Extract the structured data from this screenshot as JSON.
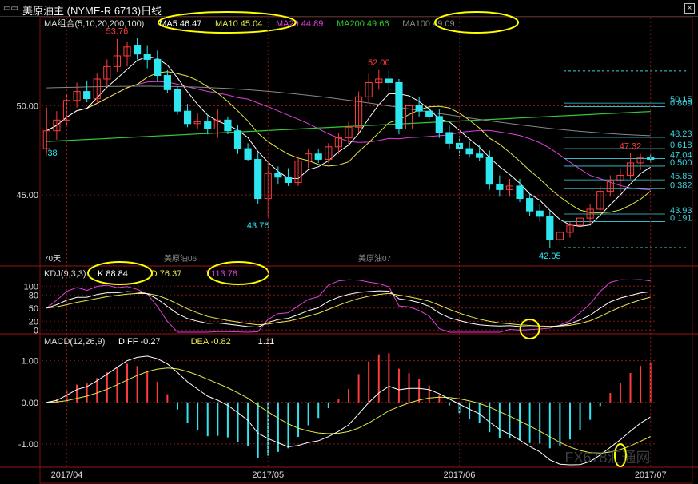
{
  "window": {
    "title": "美原油主 (NYME-R 6713)日线",
    "control": "▭▭",
    "close": "×"
  },
  "colors": {
    "up": "#ff3c3c",
    "down": "#2ee6f0",
    "ma5": "#ffffff",
    "ma10": "#e8e84a",
    "ma20": "#e040e0",
    "ma200": "#34c834",
    "ma100": "#888888",
    "grid": "#8a1414",
    "axisText": "#dddddd",
    "highlight": "#ffff00",
    "fib": "#3bd4e0"
  },
  "icons": {
    "window": "window-control-icon",
    "close": "close-icon"
  },
  "chart_data": [
    {
      "type": "candlestick",
      "panel": "price",
      "title_legend": [
        {
          "name": "MA组合(5,10,20,200,100)",
          "color": "#dddddd"
        },
        {
          "name": "MA5",
          "value": "46.47",
          "color": "#ffffff"
        },
        {
          "name": "MA10",
          "value": "45.04",
          "color": "#e8e84a"
        },
        {
          "name": "MA20",
          "value": "44.89",
          "color": "#e040e0"
        },
        {
          "name": "MA200",
          "value": "49.66",
          "color": "#34c834"
        },
        {
          "name": "MA100",
          "value": "49.09",
          "color": "#888888"
        }
      ],
      "ylim": [
        41.6,
        54.5
      ],
      "ytick_labels": [
        "50.00",
        "45.00"
      ],
      "ytick_values": [
        50,
        45
      ],
      "xtick_labels": [
        "2017/04",
        "2017/05",
        "2017/06",
        "2017/07"
      ],
      "xtick_index": [
        2,
        22,
        41,
        60
      ],
      "contract_labels": [
        "70天",
        "美原油06",
        "美原油07"
      ],
      "annotations": [
        {
          "text": "53.76",
          "index": 7,
          "value": 53.76
        },
        {
          "text": "52.00",
          "index": 33,
          "value": 52.0
        },
        {
          "text": "43.76",
          "index": 21,
          "value": 43.76
        },
        {
          "text": "42.05",
          "index": 50,
          "value": 42.05
        },
        {
          "text": "47.32",
          "index": 58,
          "value": 47.32
        },
        {
          "text": ".38",
          "index": 0,
          "value": 47.38
        }
      ],
      "fib_levels": [
        {
          "label": "50.15",
          "value": 50.15
        },
        {
          "label": "0.809",
          "value": 49.95
        },
        {
          "label": "48.23",
          "value": 48.23
        },
        {
          "label": "0.618",
          "value": 47.6
        },
        {
          "label": "47.04",
          "value": 47.04
        },
        {
          "label": "0.500",
          "value": 46.62
        },
        {
          "label": "45.85",
          "value": 45.85
        },
        {
          "label": "0.382",
          "value": 45.35
        },
        {
          "label": "43.93",
          "value": 43.93
        },
        {
          "label": "0.191",
          "value": 43.5
        }
      ],
      "fib_extra_lines": [
        51.95,
        42.05
      ],
      "candles": [
        {
          "o": 47.6,
          "h": 49.9,
          "l": 47.3,
          "c": 48.6
        },
        {
          "o": 48.6,
          "h": 49.7,
          "l": 48.1,
          "c": 49.2
        },
        {
          "o": 49.2,
          "h": 50.7,
          "l": 48.9,
          "c": 50.3
        },
        {
          "o": 50.3,
          "h": 51.3,
          "l": 49.9,
          "c": 50.8
        },
        {
          "o": 50.8,
          "h": 51.4,
          "l": 50.2,
          "c": 50.4
        },
        {
          "o": 50.4,
          "h": 51.8,
          "l": 50.2,
          "c": 51.5
        },
        {
          "o": 51.5,
          "h": 52.6,
          "l": 51.1,
          "c": 52.2
        },
        {
          "o": 52.2,
          "h": 53.76,
          "l": 51.9,
          "c": 52.8
        },
        {
          "o": 52.8,
          "h": 53.6,
          "l": 52.2,
          "c": 53.3
        },
        {
          "o": 53.4,
          "h": 53.8,
          "l": 52.6,
          "c": 52.9
        },
        {
          "o": 52.9,
          "h": 53.4,
          "l": 52.1,
          "c": 52.6
        },
        {
          "o": 52.6,
          "h": 53.1,
          "l": 51.4,
          "c": 51.7
        },
        {
          "o": 51.7,
          "h": 52.0,
          "l": 50.7,
          "c": 50.9
        },
        {
          "o": 50.9,
          "h": 51.1,
          "l": 49.5,
          "c": 49.7
        },
        {
          "o": 49.7,
          "h": 50.1,
          "l": 48.8,
          "c": 49.0
        },
        {
          "o": 49.0,
          "h": 49.6,
          "l": 48.7,
          "c": 49.1
        },
        {
          "o": 49.1,
          "h": 49.5,
          "l": 48.4,
          "c": 48.7
        },
        {
          "o": 48.7,
          "h": 49.8,
          "l": 48.2,
          "c": 49.2
        },
        {
          "o": 49.2,
          "h": 49.4,
          "l": 48.4,
          "c": 48.6
        },
        {
          "o": 48.6,
          "h": 48.9,
          "l": 47.3,
          "c": 47.6
        },
        {
          "o": 47.6,
          "h": 47.9,
          "l": 46.9,
          "c": 47.0
        },
        {
          "o": 47.0,
          "h": 47.4,
          "l": 44.5,
          "c": 44.8
        },
        {
          "o": 44.8,
          "h": 46.8,
          "l": 43.76,
          "c": 46.2
        },
        {
          "o": 46.2,
          "h": 46.6,
          "l": 45.6,
          "c": 46.0
        },
        {
          "o": 46.0,
          "h": 46.5,
          "l": 45.5,
          "c": 45.7
        },
        {
          "o": 45.7,
          "h": 47.1,
          "l": 45.5,
          "c": 46.9
        },
        {
          "o": 46.9,
          "h": 47.6,
          "l": 46.5,
          "c": 47.3
        },
        {
          "o": 47.3,
          "h": 47.6,
          "l": 46.8,
          "c": 47.0
        },
        {
          "o": 47.0,
          "h": 47.9,
          "l": 46.8,
          "c": 47.7
        },
        {
          "o": 47.7,
          "h": 48.5,
          "l": 47.3,
          "c": 48.2
        },
        {
          "o": 48.2,
          "h": 49.1,
          "l": 47.8,
          "c": 48.8
        },
        {
          "o": 48.8,
          "h": 50.8,
          "l": 48.5,
          "c": 50.5
        },
        {
          "o": 50.5,
          "h": 51.8,
          "l": 50.2,
          "c": 51.3
        },
        {
          "o": 51.3,
          "h": 52.0,
          "l": 50.9,
          "c": 51.5
        },
        {
          "o": 51.5,
          "h": 52.0,
          "l": 50.8,
          "c": 51.3
        },
        {
          "o": 51.3,
          "h": 51.5,
          "l": 48.4,
          "c": 48.7
        },
        {
          "o": 48.7,
          "h": 50.3,
          "l": 48.2,
          "c": 50.0
        },
        {
          "o": 50.0,
          "h": 50.5,
          "l": 49.4,
          "c": 49.7
        },
        {
          "o": 49.7,
          "h": 50.0,
          "l": 49.2,
          "c": 49.4
        },
        {
          "o": 49.4,
          "h": 49.8,
          "l": 48.2,
          "c": 48.5
        },
        {
          "o": 48.5,
          "h": 48.9,
          "l": 47.6,
          "c": 47.9
        },
        {
          "o": 47.9,
          "h": 48.3,
          "l": 47.2,
          "c": 47.6
        },
        {
          "o": 47.6,
          "h": 48.0,
          "l": 47.1,
          "c": 47.3
        },
        {
          "o": 47.3,
          "h": 47.8,
          "l": 46.9,
          "c": 47.1
        },
        {
          "o": 47.1,
          "h": 47.5,
          "l": 45.3,
          "c": 45.6
        },
        {
          "o": 45.6,
          "h": 46.1,
          "l": 44.9,
          "c": 45.3
        },
        {
          "o": 45.3,
          "h": 45.9,
          "l": 44.9,
          "c": 45.5
        },
        {
          "o": 45.5,
          "h": 45.9,
          "l": 44.6,
          "c": 44.8
        },
        {
          "o": 44.8,
          "h": 45.1,
          "l": 43.8,
          "c": 44.1
        },
        {
          "o": 44.1,
          "h": 44.5,
          "l": 43.5,
          "c": 43.8
        },
        {
          "o": 43.8,
          "h": 44.1,
          "l": 42.05,
          "c": 42.5
        },
        {
          "o": 42.5,
          "h": 43.2,
          "l": 42.2,
          "c": 42.9
        },
        {
          "o": 42.9,
          "h": 43.5,
          "l": 42.6,
          "c": 43.3
        },
        {
          "o": 43.3,
          "h": 44.0,
          "l": 43.0,
          "c": 43.7
        },
        {
          "o": 43.7,
          "h": 44.5,
          "l": 43.4,
          "c": 44.2
        },
        {
          "o": 44.2,
          "h": 45.5,
          "l": 43.9,
          "c": 45.2
        },
        {
          "o": 45.2,
          "h": 46.1,
          "l": 44.9,
          "c": 45.8
        },
        {
          "o": 45.8,
          "h": 46.5,
          "l": 45.2,
          "c": 46.1
        },
        {
          "o": 46.1,
          "h": 47.32,
          "l": 45.9,
          "c": 46.8
        },
        {
          "o": 46.8,
          "h": 47.3,
          "l": 46.4,
          "c": 47.1
        },
        {
          "o": 47.1,
          "h": 47.3,
          "l": 46.8,
          "c": 47.0
        }
      ]
    },
    {
      "type": "line",
      "panel": "kdj",
      "title": "KDJ(9,3,3)",
      "legend": [
        {
          "name": "K",
          "value": "88.84",
          "color": "#ffffff"
        },
        {
          "name": "D",
          "value": "76.37",
          "color": "#e8e84a"
        },
        {
          "name": "J",
          "value": "113.78",
          "color": "#e040e0"
        }
      ],
      "ylim": [
        -5,
        115
      ],
      "ytick_labels": [
        "100",
        "80",
        "50",
        "20",
        "0"
      ],
      "ytick_values": [
        100,
        80,
        50,
        20,
        0
      ]
    },
    {
      "type": "bar+line",
      "panel": "macd",
      "title": "MACD(12,26,9)",
      "legend": [
        {
          "name": "DIFF",
          "value": "-0.27",
          "color": "#ffffff"
        },
        {
          "name": "DEA",
          "value": "-0.82",
          "color": "#e8e84a"
        },
        {
          "name": "",
          "value": "1.11",
          "color": "#ffffff"
        }
      ],
      "ylim": [
        -1.5,
        1.3
      ],
      "ytick_labels": [
        "1.00",
        "0.00",
        "-1.00"
      ],
      "ytick_values": [
        1,
        0,
        -1
      ]
    }
  ],
  "watermark": "FX678汇通网"
}
